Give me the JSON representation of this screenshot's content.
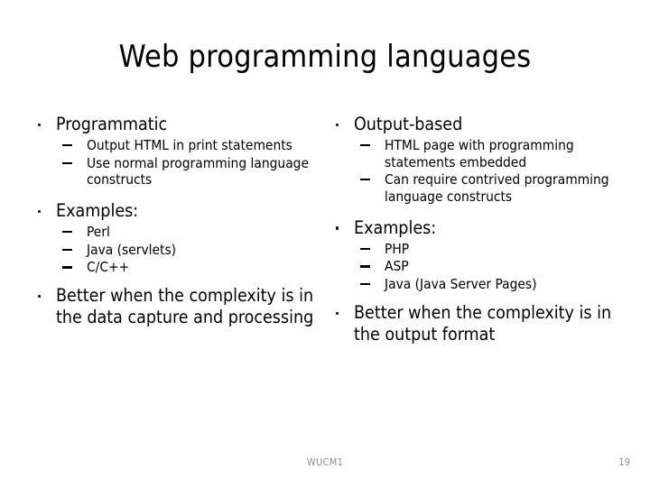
{
  "slide": {
    "title": "Web programming languages",
    "background_color": "#ffffff",
    "text_color": "#000000"
  },
  "left_column": {
    "heading": "Programmatic",
    "sub_points": [
      "Output HTML in print statements",
      "Use normal programming language constructs"
    ],
    "examples_heading": "Examples:",
    "examples": [
      "Perl",
      "Java (servlets)",
      "C/C++"
    ],
    "conclusion": "Better when the complexity is in the data capture and processing"
  },
  "right_column": {
    "heading": "Output-based",
    "sub_points": [
      "HTML page with programming statements embedded",
      "Can require contrived programming language constructs"
    ],
    "examples_heading": "Examples:",
    "examples": [
      "PHP",
      "ASP",
      "Java (Java Server Pages)"
    ],
    "conclusion": "Better when the complexity is in the output format"
  },
  "footer": {
    "label": "WUCM1",
    "page_number": "19",
    "color": "#8e8e8e"
  }
}
